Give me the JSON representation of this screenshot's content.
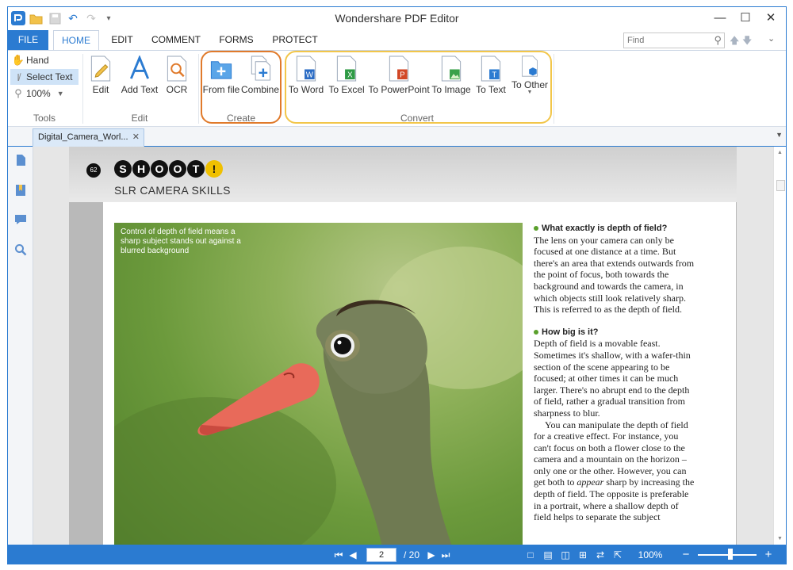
{
  "window": {
    "title": "Wondershare PDF Editor",
    "controls": [
      "minimize",
      "maximize",
      "close"
    ]
  },
  "quick_access": [
    "app-logo-icon",
    "open-folder-icon",
    "save-icon",
    "undo-icon",
    "redo-icon",
    "customize-icon"
  ],
  "ribbon_tabs": {
    "file": "FILE",
    "home": "HOME",
    "edit": "EDIT",
    "comment": "COMMENT",
    "forms": "FORMS",
    "protect": "PROTECT"
  },
  "find": {
    "placeholder": "Find"
  },
  "ribbon": {
    "tools": {
      "hand": "Hand",
      "select_text": "Select Text",
      "zoom": "100%",
      "label": "Tools"
    },
    "edit_group": {
      "edit": "Edit",
      "add_text": "Add Text",
      "ocr": "OCR",
      "label": "Edit"
    },
    "create_group": {
      "from_file": "From file",
      "combine": "Combine",
      "label": "Create"
    },
    "convert_group": {
      "to_word": "To Word",
      "to_excel": "To Excel",
      "to_powerpoint": "To PowerPoint",
      "to_image": "To Image",
      "to_text": "To Text",
      "to_other": "To Other",
      "label": "Convert"
    }
  },
  "colors": {
    "accent": "#2b7bd1",
    "create_highlight": "#e07a2b",
    "convert_highlight": "#f2c64a",
    "word": "#2b6cc4",
    "excel": "#2e9a45",
    "powerpoint": "#d24726",
    "image": "#3aa14a"
  },
  "document_tab": {
    "name": "Digital_Camera_Worl..."
  },
  "page": {
    "number_badge": "62",
    "brand": [
      "S",
      "H",
      "O",
      "O",
      "T",
      "!"
    ],
    "section": "SLR CAMERA SKILLS",
    "photo_caption": "Control of depth of field means a sharp subject stands out against a blurred background",
    "article": {
      "heading1": "What exactly is depth of field?",
      "para1": "The lens on your camera can only be focused at one distance at a time. But there's an area that extends outwards from the point of focus, both towards the background and towards the camera, in which objects still look relatively sharp. This is referred to as the depth of field.",
      "heading2": "How big is it?",
      "para2": "Depth of field is a movable feast. Sometimes it's shallow, with a wafer-thin section of the scene appearing to be focused; at other times it can be much larger. There's no abrupt end to the depth of field, rather a gradual transition from sharpness to blur.",
      "para3a": "You can manipulate the depth of field for a creative effect. For instance, you can't focus on both a flower close to the camera and a mountain on the horizon – only one or the other. However, you can get both to ",
      "para3_em": "appear",
      "para3b": " sharp by increasing the depth of field. The opposite is preferable in a portrait, where a shallow depth of field helps to separate the subject"
    }
  },
  "status": {
    "current_page": "2",
    "total_pages": "/ 20",
    "zoom": "100%",
    "zoom_level": 0.55,
    "zoom_out": "−",
    "zoom_in": "+"
  }
}
